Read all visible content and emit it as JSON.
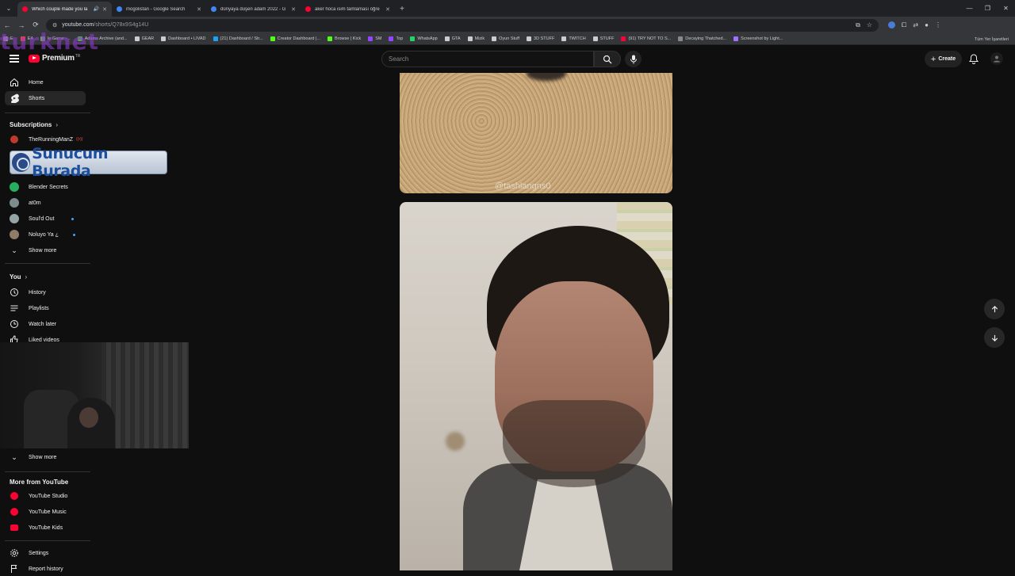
{
  "browser": {
    "tabs": [
      {
        "title": "Which couple made you la",
        "color": "#ff0033",
        "active": true
      },
      {
        "title": "mogolistan - Google Search",
        "color": "#4285f4",
        "active": false
      },
      {
        "title": "dünyaya düşen adam 2022 - G",
        "color": "#4285f4",
        "active": false
      },
      {
        "title": "aker hoca isim tamlaması öğre",
        "color": "#ff0033",
        "active": false
      }
    ],
    "url_site": "youtube.com",
    "url_path": "/shorts/Q78x9S4g14U",
    "bookmarks": [
      {
        "label": "E",
        "color": "#999"
      },
      {
        "label": "EA",
        "color": "#e44"
      },
      {
        "label": "le Game -...",
        "color": "#6a6"
      },
      {
        "label": "Adams Archive (and...",
        "color": "#4caf50"
      },
      {
        "label": "GEAR",
        "color": "#ccc"
      },
      {
        "label": "Dashboard • LIVAD",
        "color": "#ccc"
      },
      {
        "label": "(21) Dashboard / Str...",
        "color": "#1da1f2"
      },
      {
        "label": "Creator Dashboard |...",
        "color": "#53fc18"
      },
      {
        "label": "Browse | Kick",
        "color": "#53fc18"
      },
      {
        "label": "SM",
        "color": "#9146ff"
      },
      {
        "label": "Top",
        "color": "#9146ff"
      },
      {
        "label": "WhatsApp",
        "color": "#25d366"
      },
      {
        "label": "GTA",
        "color": "#ccc"
      },
      {
        "label": "Mizik",
        "color": "#ccc"
      },
      {
        "label": "Oyun Stuff",
        "color": "#ccc"
      },
      {
        "label": "3D STUFF",
        "color": "#ccc"
      },
      {
        "label": "TWITCH",
        "color": "#ccc"
      },
      {
        "label": "STUFF",
        "color": "#ccc"
      },
      {
        "label": "(91) TRY NOT TO S...",
        "color": "#ff0033"
      },
      {
        "label": "Decaying Thatched...",
        "color": "#888"
      },
      {
        "label": "Screenshot by Light...",
        "color": "#a070ff"
      }
    ],
    "bookmarks_right": "Tüm Yer İşaretleri"
  },
  "overlay": {
    "watermark": "turknet",
    "badge_text": "Sunucum Burada"
  },
  "masthead": {
    "logo_text": "Premium",
    "logo_region": "TR",
    "search_placeholder": "Search",
    "create_label": "Create"
  },
  "sidebar": {
    "main": [
      {
        "label": "Home",
        "icon": "home-icon"
      },
      {
        "label": "Shorts",
        "icon": "shorts-icon",
        "active": true
      }
    ],
    "subscriptions_title": "Subscriptions",
    "subscriptions": [
      {
        "label": "TheRunningManZ",
        "color": "#c0392b",
        "badge": "live"
      },
      {
        "label": "Blender Secrets",
        "color": "#27ae60"
      },
      {
        "label": "at0m",
        "color": "#7f8c8d"
      },
      {
        "label": "Soul'd Out",
        "color": "#95a5a6",
        "dot": true
      },
      {
        "label": "Noluyo Ya ¿",
        "color": "#8e7c68",
        "dot": true
      }
    ],
    "show_more": "Show more",
    "you_title": "You",
    "you": [
      {
        "label": "History",
        "icon": "history-icon"
      },
      {
        "label": "Playlists",
        "icon": "playlists-icon"
      },
      {
        "label": "Watch later",
        "icon": "watch-later-icon"
      },
      {
        "label": "Liked videos",
        "icon": "liked-videos-icon"
      }
    ],
    "show_more_2": "Show more",
    "more_title": "More from YouTube",
    "more": [
      {
        "label": "YouTube Studio"
      },
      {
        "label": "YouTube Music"
      },
      {
        "label": "YouTube Kids"
      }
    ],
    "settings": "Settings",
    "report_history": "Report history"
  },
  "shorts": {
    "top_watermark": "@tashlangns0"
  }
}
